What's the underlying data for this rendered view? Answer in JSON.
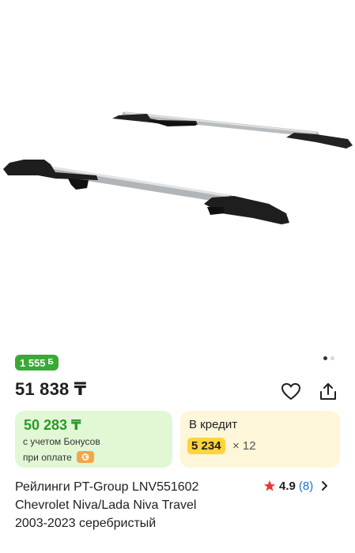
{
  "product": {
    "image_alt": "roof-rails-image",
    "gallery_dots": 2,
    "active_dot": 0
  },
  "bonus_badge": {
    "amount": "1 555",
    "unit": "Б"
  },
  "price": {
    "value": "51 838 ₸"
  },
  "actions": {
    "favorite_icon": "heart-icon",
    "share_icon": "share-icon"
  },
  "bonus_card": {
    "price": "50 283 ₸",
    "line1": "с учетом Бонусов",
    "line2": "при оплате"
  },
  "credit_card": {
    "title": "В кредит",
    "amount": "5 234",
    "months": "× 12"
  },
  "title": {
    "line1": "Рейлинги PT-Group LNV551602",
    "line2": "Chevrolet Niva/Lada Niva Travel",
    "line3": "2003-2023 серебристый"
  },
  "rating": {
    "score": "4.9",
    "open_paren": "(",
    "reviews": "8",
    "close_paren": ")"
  },
  "colors": {
    "bonus_green": "#3aa935",
    "bonus_card_bg": "#e2f7d4",
    "credit_card_bg": "#fdf6d9",
    "credit_highlight": "#ffd43b",
    "link_blue": "#1e6fd9",
    "star_red": "#e53935"
  }
}
